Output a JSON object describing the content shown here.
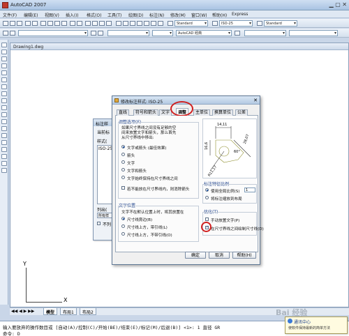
{
  "app": {
    "title": "AutoCAD 2007"
  },
  "menu": [
    "文件(F)",
    "编辑(E)",
    "视图(V)",
    "插入(I)",
    "格式(O)",
    "工具(T)",
    "绘图(D)",
    "标注(N)",
    "修改(M)",
    "窗口(W)",
    "帮助(H)",
    "Express"
  ],
  "toolbar": {
    "text_style": "Standard",
    "dim_style": "ISO-25",
    "table_style": "Standard",
    "workspace": "AutoCAD 经典"
  },
  "drawing": {
    "title": "Drawing1.dwg",
    "ucs_y": "Y",
    "ucs_x": "X"
  },
  "sheet_tabs": [
    "模型",
    "布局1",
    "布局2"
  ],
  "bg_dialog": {
    "title": "标注样",
    "current_label": "当前标",
    "styles_label": "样式(",
    "style_item": "ISO-25",
    "list_label": "列出(",
    "list_value": "所有样",
    "checkbox_label": "不列"
  },
  "dialog": {
    "title": "修改标注样式: ISO-25",
    "tabs": [
      "直线",
      "符号和箭头",
      "文字",
      "调整",
      "主单位",
      "换算单位",
      "公差"
    ],
    "active_tab": "调整",
    "fit_options": {
      "title": "调整选项(F)",
      "desc": [
        "如果尺寸界线之间没有足够的空",
        "间来放置文字和箭头，那么首先",
        "从尺寸界线中移出:"
      ],
      "options": [
        "文字或箭头 (最佳效果)",
        "箭头",
        "文字",
        "文字和箭头",
        "文字始终保持在尺寸界线之间"
      ],
      "selected": 0,
      "suppress_label": "若不能放在尺寸界线内，则消除箭头"
    },
    "text_placement": {
      "title": "文字位置",
      "desc": "文字不在默认位置上时，将其放置在",
      "options": [
        "尺寸线旁边(B)",
        "尺寸线上方，带引线(L)",
        "尺寸线上方，不带引线(O)"
      ],
      "selected": 0
    },
    "preview": {
      "dim_top": "14,11",
      "dim_left": "16,6",
      "dim_right": "28,07",
      "dim_diag": "R11,17",
      "dim_angle": "60°"
    },
    "scale": {
      "title": "标注特征比例",
      "use_global": "使用全局比例(S)",
      "global_value": "1",
      "scale_to_layout": "将标注缩放到布局"
    },
    "fine_tuning": {
      "title": "优化(T)",
      "manual_text": "手动放置文字(P)",
      "draw_between": "在尺寸界线之间绘制尺寸线(D)",
      "manual_checked": false,
      "draw_checked": true
    },
    "buttons": {
      "ok": "确定",
      "cancel": "取消",
      "help": "帮助(H)"
    },
    "highlight_color": "#d01f1f"
  },
  "command": {
    "line1": "输入要放弃的操作数目或 [自动(A)/控制(C)/开始(BE)/结束(E)/标记(M)/后退(B)] <1>: 1 直径 GR",
    "line2": "命令: D"
  },
  "notify": {
    "title": "通讯中心",
    "body": "使软件保持最新的简单方法"
  },
  "watermark": "Bai 经验"
}
